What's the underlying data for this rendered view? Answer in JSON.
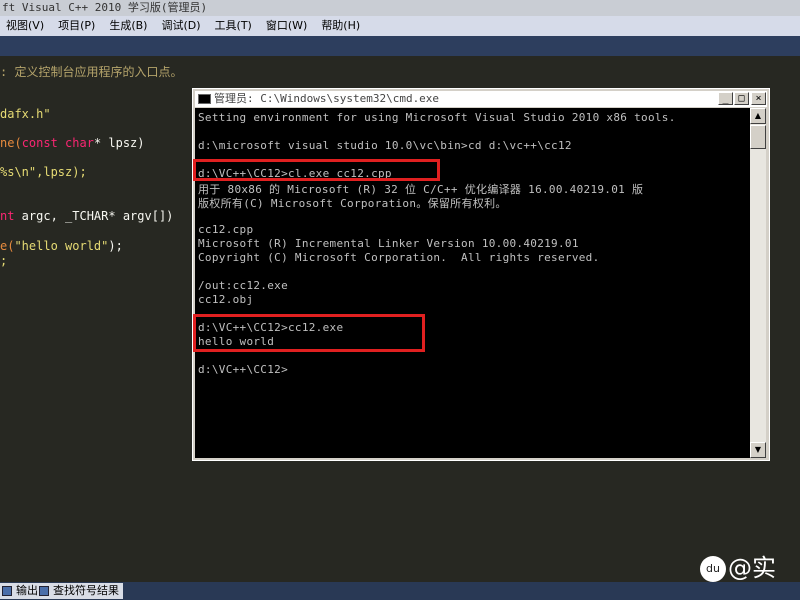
{
  "window_title": "ft Visual C++ 2010 学习版(管理员)",
  "menu": [
    "视图(V)",
    "项目(P)",
    "生成(B)",
    "调试(D)",
    "工具(T)",
    "窗口(W)",
    "帮助(H)"
  ],
  "editor": {
    "lines": [
      {
        "t": ": 定义控制台应用程序的入口点。",
        "c": "comment"
      },
      {
        "t": "dafx.h\"",
        "c": "string"
      },
      {
        "a": "ne(",
        "b": "const char",
        "d": "* lpsz)"
      },
      {
        "t": "%s\\n\",lpsz);",
        "c": "string"
      },
      {
        "a": "nt",
        "b": "",
        "d": " argc, _TCHAR* argv[])"
      },
      {
        "a": "e(",
        "b": "\"hello world\"",
        "d": ");"
      },
      {
        "t": ";",
        "c": "string"
      }
    ]
  },
  "cmd": {
    "title": "管理员: C:\\Windows\\system32\\cmd.exe",
    "buttons": {
      "min": "_",
      "max": "□",
      "close": "×"
    },
    "lines": [
      "Setting environment for using Microsoft Visual Studio 2010 x86 tools.",
      "",
      "d:\\microsoft visual studio 10.0\\vc\\bin>cd d:\\vc++\\cc12",
      "",
      "d:\\VC++\\CC12>cl.exe cc12.cpp",
      "用于 80x86 的 Microsoft (R) 32 位 C/C++ 优化编译器 16.00.40219.01 版",
      "版权所有(C) Microsoft Corporation。保留所有权利。",
      "",
      "cc12.cpp",
      "Microsoft (R) Incremental Linker Version 10.00.40219.01",
      "Copyright (C) Microsoft Corporation.  All rights reserved.",
      "",
      "/out:cc12.exe",
      "cc12.obj",
      "",
      "d:\\VC++\\CC12>cc12.exe",
      "hello world",
      "",
      "d:\\VC++\\CC12>"
    ]
  },
  "bottom_tabs": [
    "输出",
    "查找符号结果"
  ],
  "watermark": "@实",
  "watermark_logo": "du",
  "colors": {
    "highlight": "#e02020",
    "console_bg": "#000000",
    "console_text": "#c0c0c0",
    "editor_bg": "#272822"
  }
}
